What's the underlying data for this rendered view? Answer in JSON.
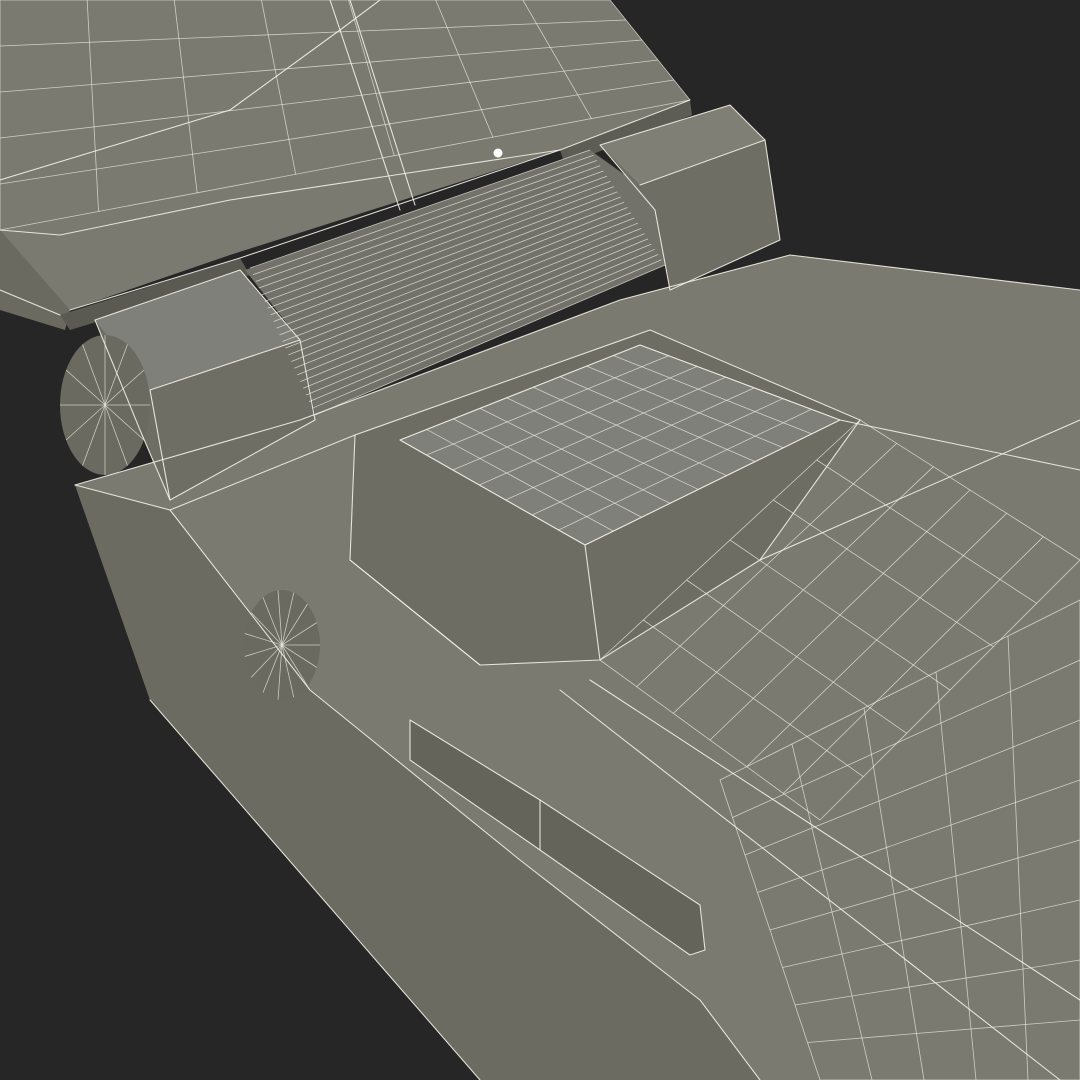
{
  "scene": {
    "subject": "3d-wireframe-flip-phone-hinge",
    "colors": {
      "background": "#262626",
      "surface": "#75756b",
      "surface_dark": "#5f5f56",
      "surface_light": "#8a8a7f",
      "wire": "#f2f0e6"
    }
  }
}
